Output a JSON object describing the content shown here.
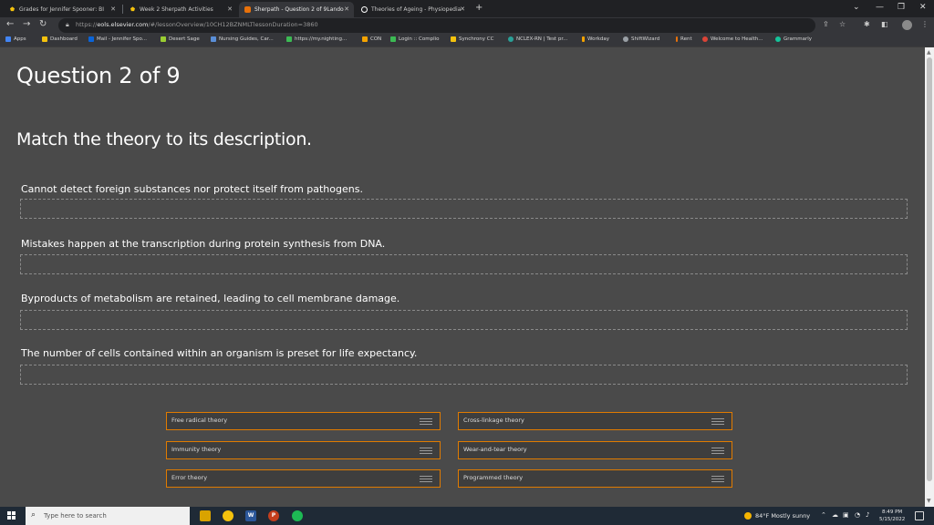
{
  "browser": {
    "tabs": [
      {
        "title": "Grades for Jennifer Spooner: BI",
        "icon_color": "#f4c20d"
      },
      {
        "title": "Week 2 Sherpath Activities",
        "icon_color": "#f4c20d"
      },
      {
        "title": "Sherpath - Question 2 of 9Lando",
        "icon_color": "#e8710a",
        "active": true
      },
      {
        "title": "Theories of Ageing - Physiopedia",
        "icon_color": "#ffffff"
      }
    ],
    "url_prefix": "https://",
    "url_domain": "eols.elsevier.com",
    "url_path": "/#/lessonOverview/10CH12BZNMLTlessonDuration=3860",
    "bookmarks": [
      {
        "label": "Apps",
        "icon_color": "#4285f4"
      },
      {
        "label": "Dashboard",
        "icon_color": "#f4c20d"
      },
      {
        "label": "Mail - Jennifer Spo...",
        "icon_color": "#0a64d8"
      },
      {
        "label": "Desert Sage",
        "icon_color": "#9acd32"
      },
      {
        "label": "Nursing Guides, Car...",
        "icon_color": "#5a8fd8"
      },
      {
        "label": "https://my.nighting...",
        "icon_color": "#3cba54"
      },
      {
        "label": "CON",
        "icon_color": "#f4a300"
      },
      {
        "label": "Login :: Complio",
        "icon_color": "#3cba54"
      },
      {
        "label": "Synchrony CC",
        "icon_color": "#f4c20d"
      },
      {
        "label": "NCLEX-RN | Test pr...",
        "icon_color": "#2aa198"
      },
      {
        "label": "Workday",
        "icon_color": "#f4a300"
      },
      {
        "label": "ShiftWizard",
        "icon_color": "#9aa0a6"
      },
      {
        "label": "Rent",
        "icon_color": "#e8710a"
      },
      {
        "label": "Welcome to Health...",
        "icon_color": "#db4437"
      },
      {
        "label": "Grammarly",
        "icon_color": "#15c39a"
      }
    ]
  },
  "question": {
    "title": "Question 2 of 9",
    "instruction": "Match the theory to its description.",
    "descriptions": [
      "Cannot detect foreign substances nor protect itself from pathogens.",
      "Mistakes happen at the transcription during protein synthesis from DNA.",
      "Byproducts of metabolism are retained, leading to cell membrane damage.",
      "The number of cells contained within an organism is preset for life expectancy."
    ],
    "choices": [
      "Free radical theory",
      "Cross-linkage theory",
      "Immunity theory",
      "Wear-and-tear theory",
      "Error theory",
      "Programmed theory"
    ],
    "accent_color": "#e07b00"
  },
  "taskbar": {
    "search_placeholder": "Type here to search",
    "weather": "84°F  Mostly sunny",
    "time": "8:49 PM",
    "date": "5/15/2022"
  }
}
